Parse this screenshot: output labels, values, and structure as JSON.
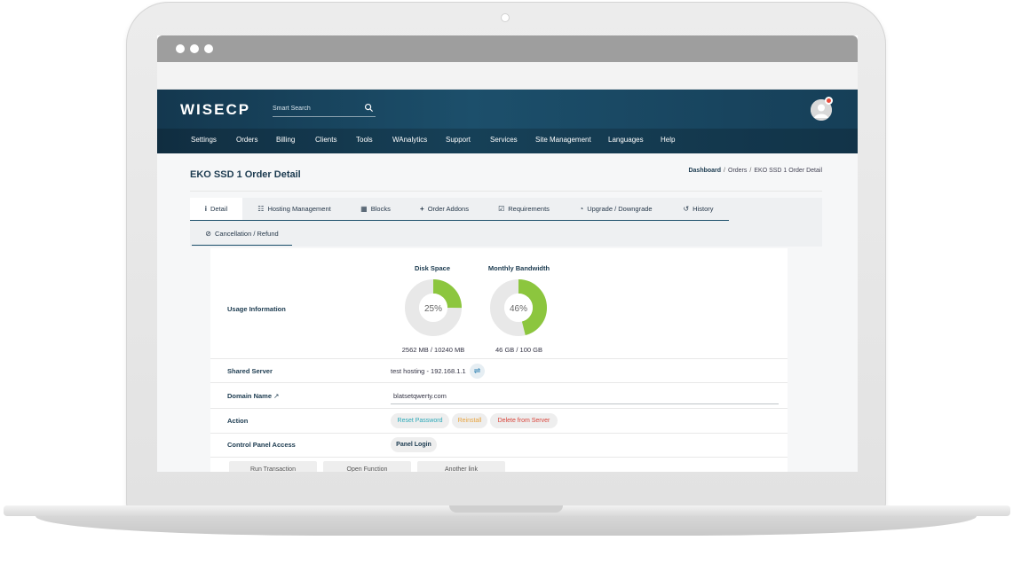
{
  "app": {
    "logo": "WISECP",
    "search_placeholder": "Smart Search",
    "nav": [
      "Settings",
      "Orders",
      "Billing",
      "Clients",
      "Tools",
      "WAnalytics",
      "Support",
      "Services",
      "Site Management",
      "Languages",
      "Help"
    ]
  },
  "page": {
    "title": "EKO SSD 1 Order Detail",
    "breadcrumb": {
      "home": "Dashboard",
      "orders": "Orders",
      "current": "EKO SSD 1 Order Detail",
      "separator": "/"
    }
  },
  "tabs": [
    {
      "label": "Detail",
      "icon": "info-icon",
      "glyph": "i"
    },
    {
      "label": "Hosting Management",
      "icon": "server-list-icon",
      "glyph": "☷"
    },
    {
      "label": "Blocks",
      "icon": "blocks-icon",
      "glyph": "▦"
    },
    {
      "label": "Order Addons",
      "icon": "plus-icon",
      "glyph": "+"
    },
    {
      "label": "Requirements",
      "icon": "checkbox-icon",
      "glyph": "☑"
    },
    {
      "label": "Upgrade / Downgrade",
      "icon": "speedometer-icon",
      "glyph": "◔"
    },
    {
      "label": "History",
      "icon": "history-icon",
      "glyph": "↺"
    },
    {
      "label": "Cancellation / Refund",
      "icon": "ban-icon",
      "glyph": "⊘"
    }
  ],
  "usage": {
    "label": "Usage Information",
    "disk": {
      "title": "Disk Space",
      "percent": 25,
      "percent_label": "25%",
      "caption": "2562 MB / 10240 MB"
    },
    "bandwidth": {
      "title": "Monthly Bandwidth",
      "percent": 46,
      "percent_label": "46%",
      "caption": "46 GB / 100 GB"
    },
    "colors": {
      "used": "#8cc63e",
      "free": "#e8e8e8"
    }
  },
  "shared_server": {
    "label": "Shared Server",
    "value": "test hosting - 192.168.1.1",
    "swap_glyph": "⇌"
  },
  "domain": {
    "label": "Domain Name",
    "value": "blatsetqwerty.com",
    "link_glyph": "↗"
  },
  "actions": {
    "label": "Action",
    "reset": "Reset Password",
    "reinstall": "Reinstall",
    "delete": "Delete from Server",
    "colors": {
      "reset": "#2aa8b8",
      "reinstall": "#e8a33d",
      "delete": "#d9443a"
    }
  },
  "control_panel": {
    "label": "Control Panel Access",
    "button": "Panel Login"
  },
  "bottom_buttons": [
    "Run Transaction",
    "Open Function",
    "Another link"
  ]
}
